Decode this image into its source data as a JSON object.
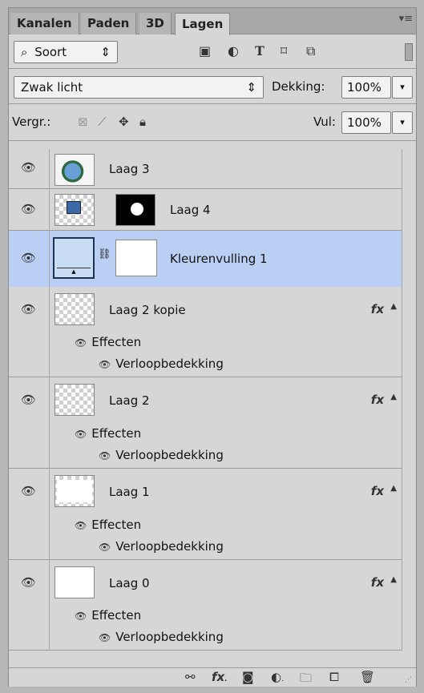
{
  "tabs": [
    "Kanalen",
    "Paden",
    "3D",
    "Lagen"
  ],
  "filter": {
    "label": "Soort",
    "icons": [
      "image-filter-icon",
      "adjustment-filter-icon",
      "type-filter-icon",
      "shape-filter-icon",
      "smart-object-filter-icon"
    ]
  },
  "blend": {
    "mode": "Zwak licht",
    "opacity_label": "Dekking:",
    "opacity_value": "100%"
  },
  "locks": {
    "label": "Vergr.:",
    "fill_label": "Vul:",
    "fill_value": "100%"
  },
  "layers": [
    {
      "name": "Laag 3"
    },
    {
      "name": "Laag 4"
    },
    {
      "name": "Kleurenvulling 1"
    },
    {
      "name": "Laag 2 kopie",
      "effects": "Effecten",
      "effect": "Verloopbedekking"
    },
    {
      "name": "Laag 2",
      "effects": "Effecten",
      "effect": "Verloopbedekking"
    },
    {
      "name": "Laag 1",
      "effects": "Effecten",
      "effect": "Verloopbedekking"
    },
    {
      "name": "Laag 0",
      "effects": "Effecten",
      "effect": "Verloopbedekking"
    }
  ],
  "fx_label": "fx",
  "colors": {
    "selected_row": "#b9cff4",
    "panel_bg": "#d6d6d6"
  }
}
